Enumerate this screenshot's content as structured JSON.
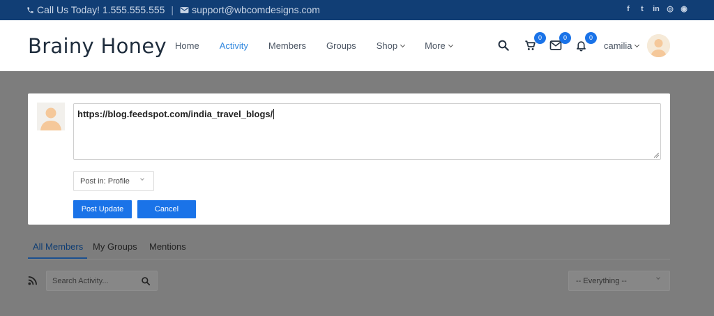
{
  "topbar": {
    "phone_text": "Call Us Today! 1.555.555.555",
    "separator": "|",
    "email_text": "support@wbcomdesigns.com",
    "social": [
      {
        "name": "facebook-icon",
        "glyph": "f"
      },
      {
        "name": "twitter-icon",
        "glyph": "t"
      },
      {
        "name": "linkedin-icon",
        "glyph": "in"
      },
      {
        "name": "dribbble-icon",
        "glyph": "◎"
      },
      {
        "name": "github-icon",
        "glyph": "◉"
      }
    ]
  },
  "header": {
    "logo": "Brainy Honey",
    "nav": [
      {
        "label": "Home",
        "active": false,
        "dropdown": false
      },
      {
        "label": "Activity",
        "active": true,
        "dropdown": false
      },
      {
        "label": "Members",
        "active": false,
        "dropdown": false
      },
      {
        "label": "Groups",
        "active": false,
        "dropdown": false
      },
      {
        "label": "Shop",
        "active": false,
        "dropdown": true
      },
      {
        "label": "More",
        "active": false,
        "dropdown": true
      }
    ],
    "cart_count": "0",
    "messages_count": "0",
    "notifications_count": "0",
    "username": "camilia"
  },
  "post_form": {
    "text": "https://blog.feedspot.com/india_travel_blogs/",
    "post_in": "Post in: Profile",
    "submit_label": "Post Update",
    "cancel_label": "Cancel"
  },
  "tabs": [
    {
      "label": "All Members",
      "active": true
    },
    {
      "label": "My Groups",
      "active": false
    },
    {
      "label": "Mentions",
      "active": false
    }
  ],
  "filters": {
    "search_placeholder": "Search Activity...",
    "show_value": "-- Everything --"
  },
  "colors": {
    "topbar": "#113e75",
    "accent": "#1a73e8",
    "active_nav": "#2e86de",
    "overlay": "#7d7d7d"
  }
}
